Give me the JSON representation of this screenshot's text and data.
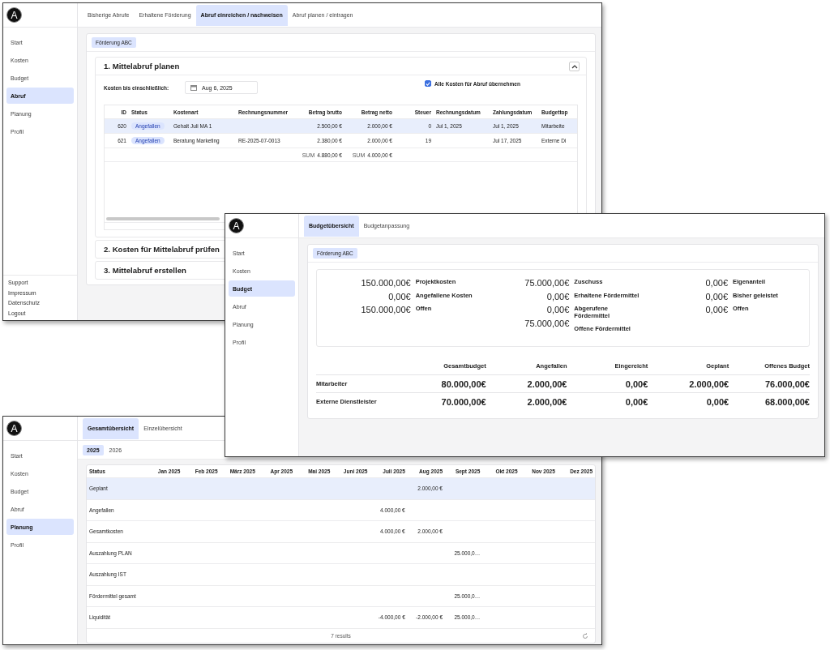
{
  "abruf_window": {
    "logo": "A",
    "nav": [
      {
        "label": "Start",
        "selected": false
      },
      {
        "label": "Kosten",
        "selected": false
      },
      {
        "label": "Budget",
        "selected": false
      },
      {
        "label": "Abruf",
        "selected": true
      },
      {
        "label": "Planung",
        "selected": false
      },
      {
        "label": "Profil",
        "selected": false
      }
    ],
    "footer_links": [
      "Support",
      "Impressum",
      "Datenschutz",
      "Logout"
    ],
    "tabs": [
      {
        "label": "Bisherige Abrufe",
        "selected": false
      },
      {
        "label": "Erhaltene Förderung",
        "selected": false
      },
      {
        "label": "Abruf einreichen / nachweisen",
        "selected": true
      },
      {
        "label": "Abruf planen / eintragen",
        "selected": false
      }
    ],
    "chip": "Förderung ABC",
    "steps": [
      {
        "title": "1. Mittelabruf planen",
        "expanded": true,
        "date_label": "Kosten bis einschließlich:",
        "date": "Aug 6, 2025",
        "take_all": {
          "label": "Alle Kosten für Abruf übernehmen",
          "checked": true
        },
        "table": {
          "columns": [
            "ID",
            "Status",
            "Kostenart",
            "Rechnungsnummer",
            "Betrag brutto",
            "Betrag netto",
            "Steuer",
            "Rechnungsdatum",
            "Zahlungsdatum",
            "Budgettop"
          ],
          "rows": [
            {
              "selected": true,
              "cells": [
                "620",
                "Angefallen",
                "Gehalt Juli MA 1",
                null,
                "2.500,00 €",
                "2.000,00 €",
                "0",
                "Jul 1, 2025",
                "Jul 1, 2025",
                "Mitarbeite"
              ]
            },
            {
              "selected": false,
              "cells": [
                "621",
                "Angefallen",
                "Beratung Marketing",
                "RE-2025-07-0013",
                "2.380,00 €",
                "2.000,00 €",
                "19",
                null,
                "Jul 17, 2025",
                "Externe Di"
              ]
            }
          ],
          "sums": [
            {
              "label": "SUM",
              "value": "4.880,00 €"
            },
            {
              "label": "SUM",
              "value": "4.000,00 €"
            }
          ]
        }
      },
      {
        "title": "2. Kosten für Mittelabruf prüfen",
        "expanded": false
      },
      {
        "title": "3. Mittelabruf erstellen",
        "expanded": false
      }
    ]
  },
  "budget_window": {
    "logo": "A",
    "nav": [
      {
        "label": "Start",
        "selected": false
      },
      {
        "label": "Kosten",
        "selected": false
      },
      {
        "label": "Budget",
        "selected": true
      },
      {
        "label": "Abruf",
        "selected": false
      },
      {
        "label": "Planung",
        "selected": false
      },
      {
        "label": "Profil",
        "selected": false
      }
    ],
    "tabs": [
      {
        "label": "Budgetübersicht",
        "selected": true
      },
      {
        "label": "Budgetanpassung",
        "selected": false
      }
    ],
    "chip": "Förderung ABC",
    "summary": [
      {
        "values": [
          "150.000,00€",
          "0,00€",
          "150.000,00€"
        ],
        "labels": [
          "Projektkosten",
          "Angefallene Kosten",
          "Offen"
        ]
      },
      {
        "values": [
          "75.000,00€",
          "0,00€",
          "0,00€",
          "75.000,00€"
        ],
        "labels": [
          "Zuschuss",
          "Erhaltene Fördermittel",
          "Abgerufene Fördermittel",
          "Offene Fördermittel"
        ]
      },
      {
        "values": [
          "0,00€",
          "0,00€",
          "0,00€"
        ],
        "labels": [
          "Eigenanteil",
          "Bisher geleistet",
          "Offen"
        ]
      }
    ],
    "table": {
      "columns": [
        "Gesamtbudget",
        "Angefallen",
        "Eingereicht",
        "Geplant",
        "Offenes Budget"
      ],
      "rows": [
        {
          "label": "Mitarbeiter",
          "values": [
            "80.000,00€",
            "2.000,00€",
            "0,00€",
            "2.000,00€",
            "76.000,00€"
          ]
        },
        {
          "label": "Externe Dienstleister",
          "values": [
            "70.000,00€",
            "2.000,00€",
            "0,00€",
            "0,00€",
            "68.000,00€"
          ]
        }
      ]
    }
  },
  "planung_window": {
    "logo": "A",
    "nav": [
      {
        "label": "Start",
        "selected": false
      },
      {
        "label": "Kosten",
        "selected": false
      },
      {
        "label": "Budget",
        "selected": false
      },
      {
        "label": "Abruf",
        "selected": false
      },
      {
        "label": "Planung",
        "selected": true
      },
      {
        "label": "Profil",
        "selected": false
      }
    ],
    "tabs": [
      {
        "label": "Gesamtübersicht",
        "selected": true
      },
      {
        "label": "Einzelübersicht",
        "selected": false
      }
    ],
    "years": [
      {
        "label": "2025",
        "selected": true
      },
      {
        "label": "2026",
        "selected": false
      }
    ],
    "table": {
      "columns": [
        "Status",
        "Jan 2025",
        "Feb 2025",
        "März 2025",
        "Apr 2025",
        "Mai 2025",
        "Juni 2025",
        "Juli 2025",
        "Aug 2025",
        "Sept 2025",
        "Okt 2025",
        "Nov 2025",
        "Dez 2025"
      ],
      "rows": [
        {
          "selected": true,
          "cells": [
            "Geplant",
            null,
            null,
            null,
            null,
            null,
            null,
            null,
            "2.000,00 €",
            null,
            null,
            null,
            null
          ]
        },
        {
          "selected": false,
          "cells": [
            "Angefallen",
            null,
            null,
            null,
            null,
            null,
            null,
            "4.000,00 €",
            null,
            null,
            null,
            null,
            null
          ]
        },
        {
          "selected": false,
          "cells": [
            "Gesamtkosten",
            null,
            null,
            null,
            null,
            null,
            null,
            "4.000,00 €",
            "2.000,00 €",
            null,
            null,
            null,
            null
          ]
        },
        {
          "selected": false,
          "cells": [
            "Auszahlung PLAN",
            null,
            null,
            null,
            null,
            null,
            null,
            null,
            null,
            "25.000,0…",
            null,
            null,
            null
          ]
        },
        {
          "selected": false,
          "cells": [
            "Auszahlung IST",
            null,
            null,
            null,
            null,
            null,
            null,
            null,
            null,
            null,
            null,
            null,
            null
          ]
        },
        {
          "selected": false,
          "cells": [
            "Fördermittel gesamt",
            null,
            null,
            null,
            null,
            null,
            null,
            null,
            null,
            "25.000,0…",
            null,
            null,
            null
          ]
        },
        {
          "selected": false,
          "cells": [
            "Liquidität",
            null,
            null,
            null,
            null,
            null,
            null,
            "-4.000,00 €",
            "-2.000,00 €",
            "25.000,0…",
            null,
            null,
            null
          ]
        }
      ],
      "footer": "7 results"
    }
  }
}
